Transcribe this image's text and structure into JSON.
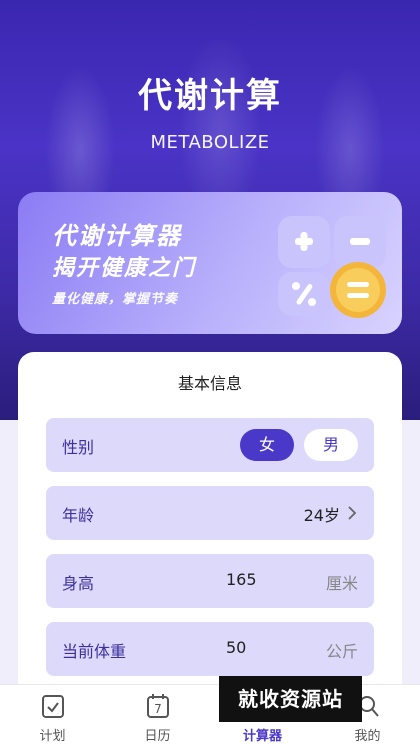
{
  "header": {
    "title": "代谢计算",
    "subtitle": "METABOLIZE"
  },
  "banner": {
    "line1": "代谢计算器",
    "line2": "揭开健康之门",
    "line3": "量化健康，掌握节奏"
  },
  "card": {
    "title": "基本信息",
    "gender": {
      "label": "性别",
      "options": [
        "女",
        "男"
      ],
      "selected": "女"
    },
    "age": {
      "label": "年龄",
      "value": "24岁"
    },
    "height": {
      "label": "身高",
      "value": "165",
      "unit": "厘米"
    },
    "weight": {
      "label": "当前体重",
      "value": "50",
      "unit": "公斤"
    }
  },
  "tabs": [
    {
      "label": "计划",
      "icon": "plan-icon"
    },
    {
      "label": "日历",
      "icon": "calendar-icon",
      "day": "7"
    },
    {
      "label": "计算器",
      "icon": "calculator-icon",
      "active": true
    },
    {
      "label": "我的",
      "icon": "profile-icon"
    }
  ],
  "watermark": "就收资源站",
  "colors": {
    "accent": "#4a38c9",
    "row_bg": "#dcd9fa",
    "hero": "#3a27b0"
  }
}
